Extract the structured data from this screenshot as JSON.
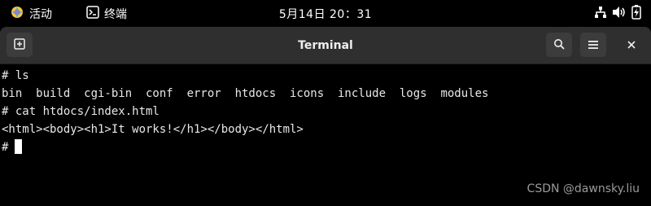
{
  "topbar": {
    "activities_label": "活动",
    "app_label": "终端",
    "clock": "5月14日  20：31"
  },
  "window": {
    "title": "Terminal"
  },
  "terminal": {
    "lines": [
      "# ls",
      "bin  build  cgi-bin  conf  error  htdocs  icons  include  logs  modules",
      "# cat htdocs/index.html",
      "<html><body><h1>It works!</h1></body></html>",
      "#"
    ]
  },
  "watermark": "CSDN @dawnsky.liu",
  "icons": {
    "activities": "activities-icon",
    "app": "terminal-app-icon",
    "network": "network-icon",
    "volume": "volume-icon",
    "battery": "battery-icon",
    "new_tab": "new-tab-icon",
    "search": "search-icon",
    "menu": "hamburger-menu-icon",
    "close": "close-icon"
  }
}
